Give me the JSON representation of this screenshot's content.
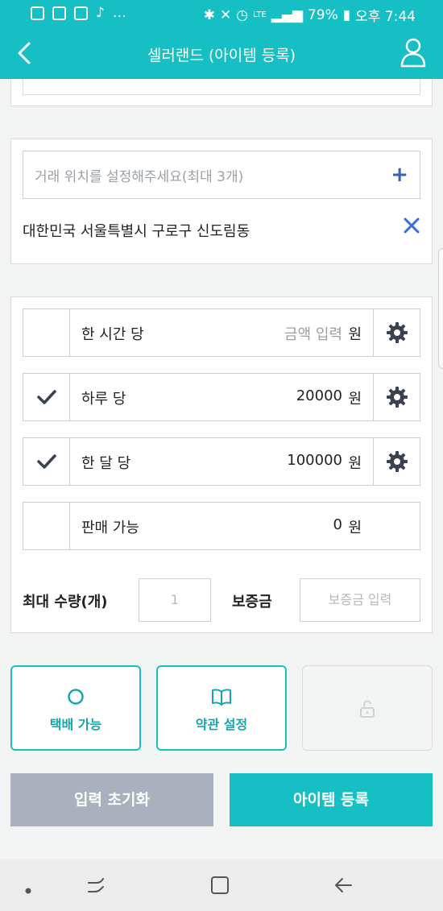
{
  "status_bar": {
    "battery": "79%",
    "time": "오후 7:44",
    "network": "LTE"
  },
  "app_bar": {
    "title": "셀러랜드 (아이템 등록)"
  },
  "location": {
    "placeholder": "거래 위치를 설정해주세요(최대 3개)",
    "items": [
      "대한민국 서울특별시 구로구 신도림동"
    ]
  },
  "pricing": {
    "rows": [
      {
        "label": "한 시간 당",
        "value": "금액 입력",
        "unit": "원",
        "checked": false
      },
      {
        "label": "하루 당",
        "value": "20000",
        "unit": "원",
        "checked": true
      },
      {
        "label": "한 달 당",
        "value": "100000",
        "unit": "원",
        "checked": true
      },
      {
        "label": "판매 가능",
        "value": "0",
        "unit": "원",
        "checked": false
      }
    ],
    "max_qty_label": "최대 수량(개)",
    "max_qty_value": "1",
    "deposit_label": "보증금",
    "deposit_placeholder": "보증금 입력"
  },
  "options": {
    "delivery_label": "택배 가능",
    "terms_label": "약관 설정"
  },
  "actions": {
    "reset_label": "입력 초기화",
    "submit_label": "아이템 등록"
  },
  "colors": {
    "accent": "#16bfc3",
    "reset": "#aab0bd",
    "blue": "#3a5fb8"
  }
}
